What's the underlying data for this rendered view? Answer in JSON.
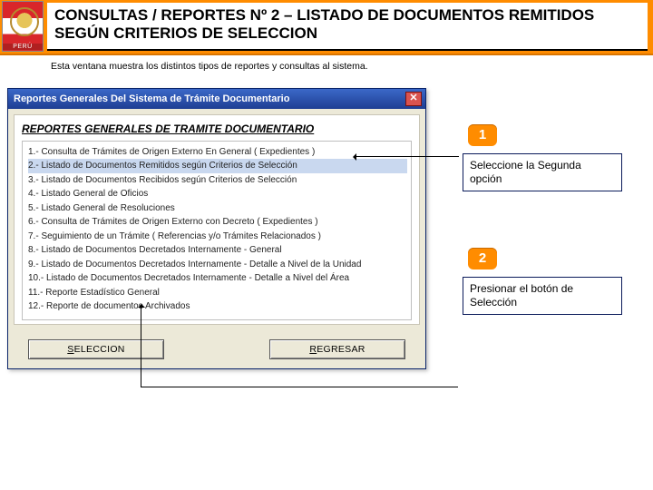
{
  "header": {
    "emblem_caption": "PERÚ",
    "title": "CONSULTAS / REPORTES Nº 2 – LISTADO DE DOCUMENTOS REMITIDOS SEGÚN CRITERIOS DE SELECCION",
    "subtitle": "Esta ventana muestra los distintos tipos de reportes y consultas al sistema."
  },
  "dialog": {
    "titlebar": "Reportes Generales Del Sistema de Trámite Documentario",
    "heading": "REPORTES  GENERALES DE TRAMITE DOCUMENTARIO",
    "selected_index": 1,
    "items": [
      "1.- Consulta de Trámites de Origen Externo En General  ( Expedientes )",
      "2.- Listado de Documentos Remitidos según Criterios de Selección",
      "3.- Listado de Documentos Recibidos según Criterios de Selección",
      "4.- Listado General de Oficios",
      "5.- Listado General de Resoluciones",
      "6.- Consulta de Trámites de Origen Externo con Decreto  ( Expedientes )",
      "7.- Seguimiento de un Trámite  ( Referencias y/o Trámites Relacionados )",
      "8.- Listado de Documentos Decretados Internamente - General",
      "9.- Listado de Documentos Decretados Internamente - Detalle a Nivel de la Unidad",
      "10.- Listado de Documentos Decretados Internamente - Detalle a Nivel del Área",
      "11.- Reporte Estadístico General",
      "12.- Reporte de documentos Archivados"
    ],
    "buttons": {
      "select": "SELECCION",
      "back": "REGRESAR"
    }
  },
  "callouts": {
    "c1": {
      "num": "1",
      "text": "Seleccione la Segunda opción"
    },
    "c2": {
      "num": "2",
      "text": "Presionar el botón de Selección"
    }
  }
}
